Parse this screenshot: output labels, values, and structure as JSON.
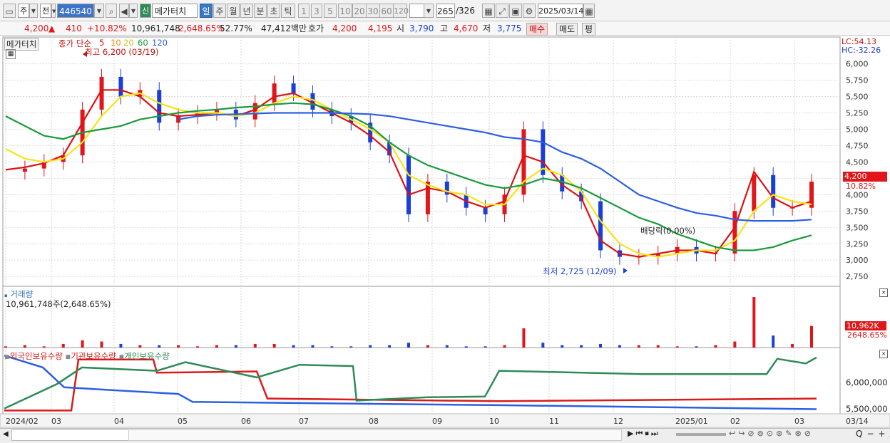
{
  "toolbar": {
    "market": "주",
    "type": "전",
    "code": "446540",
    "new_badge": "신",
    "stock_name": "메가터치",
    "periods": [
      "일",
      "주",
      "월",
      "년",
      "분",
      "초",
      "틱"
    ],
    "selected_period": "일",
    "minute_options": [
      "1",
      "3",
      "5",
      "10",
      "20",
      "30",
      "60",
      "120"
    ],
    "count": "265",
    "total": "/326",
    "date": "2025/03/14"
  },
  "quote": {
    "price": "4,200",
    "change": "410",
    "change_pct": "+10.82%",
    "volume": "10,961,748",
    "volume_pct": "2,648.65%",
    "turnover": "52.77%",
    "amount": "47,412백만",
    "hoga_label": "호가",
    "ask": "4,200",
    "bid": "4,195",
    "open_label": "시",
    "open": "3,790",
    "high_label": "고",
    "high": "4,670",
    "low_label": "저",
    "low": "3,775",
    "buy_label": "매수",
    "sell_label": "매도",
    "eval_label": "평"
  },
  "price_panel": {
    "name": "메가터치",
    "ma_label": "종가 단순",
    "ma_periods": [
      "5",
      "10",
      "20",
      "60",
      "120"
    ],
    "ma_colors": [
      "#dd1111",
      "#f08a10",
      "#f4e417",
      "#1a9a3a",
      "#2c5fe0"
    ],
    "high_note": "최고 6,200 (03/19)",
    "low_note": "최저 2,725 (12/09)",
    "dividend_note": "배당락(0.00%)",
    "lc": "LC:54.13",
    "hc": "HC:-32.26",
    "last_price": "4,200",
    "last_pct": "10.82%"
  },
  "volume_panel": {
    "title": "거래량",
    "info": "10,961,748주(2,648.65%)",
    "last_tag": "10,962K",
    "last_pct": "2648.65%"
  },
  "holdings_panel": {
    "legend": [
      "외국인보유수량",
      "기관보유수량",
      "개인보유수량"
    ],
    "colors": [
      "#d81b1b",
      "#2c5fe0",
      "#2e8b57"
    ],
    "axis_labels": [
      "6,000,000",
      "5,500,000"
    ]
  },
  "x_axis": [
    "2024/02",
    "03",
    "04",
    "05",
    "06",
    "07",
    "08",
    "09",
    "10",
    "11",
    "12",
    "2025/01",
    "02",
    "03"
  ],
  "x_end_label": "03/14",
  "chart_data": {
    "type": "candlestick",
    "title": "메가터치",
    "ylim": [
      2600,
      6300
    ],
    "y_ticks": [
      "6,000",
      "5,750",
      "5,500",
      "5,250",
      "5,000",
      "4,750",
      "4,500",
      "4,250",
      "4,000",
      "3,750",
      "3,500",
      "3,250",
      "3,000",
      "2,750"
    ],
    "series": [
      {
        "name": "close",
        "values": [
          4350,
          4400,
          4500,
          4600,
          5300,
          5800,
          5500,
          5600,
          5100,
          5200,
          5250,
          5300,
          5150,
          5400,
          5700,
          5550,
          5300,
          5200,
          5100,
          4800,
          4600,
          3700,
          4200,
          4000,
          3800,
          3700,
          4000,
          5000,
          4300,
          4050,
          3900,
          3150,
          3050,
          3050,
          3100,
          3200,
          3100,
          3100,
          3750,
          4300,
          3800,
          3800,
          4200
        ]
      },
      {
        "name": "ma5",
        "values": [
          4380,
          4420,
          4480,
          4600,
          5100,
          5600,
          5600,
          5500,
          5250,
          5200,
          5220,
          5250,
          5200,
          5300,
          5500,
          5550,
          5400,
          5250,
          5100,
          4900,
          4650,
          4000,
          4100,
          4050,
          3900,
          3800,
          3900,
          4600,
          4500,
          4150,
          3950,
          3300,
          3100,
          3050,
          3100,
          3150,
          3150,
          3100,
          3500,
          4350,
          3950,
          3800,
          3900
        ]
      },
      {
        "name": "ma20",
        "values": [
          4700,
          4550,
          4500,
          4550,
          4800,
          5200,
          5500,
          5550,
          5400,
          5300,
          5250,
          5250,
          5200,
          5250,
          5400,
          5500,
          5450,
          5300,
          5150,
          5000,
          4800,
          4300,
          4150,
          4050,
          4000,
          3850,
          3850,
          4200,
          4400,
          4300,
          4050,
          3600,
          3250,
          3100,
          3050,
          3100,
          3150,
          3150,
          3300,
          3750,
          4000,
          3900,
          3850
        ]
      },
      {
        "name": "ma60",
        "values": [
          5200,
          5050,
          4900,
          4850,
          4950,
          5000,
          5050,
          5150,
          5200,
          5250,
          5280,
          5300,
          5330,
          5350,
          5380,
          5400,
          5380,
          5300,
          5200,
          5050,
          4800,
          4600,
          4450,
          4350,
          4250,
          4150,
          4100,
          4150,
          4250,
          4200,
          4100,
          3950,
          3800,
          3650,
          3550,
          3400,
          3300,
          3200,
          3150,
          3150,
          3200,
          3300,
          3380
        ]
      },
      {
        "name": "ma120",
        "values": [
          null,
          null,
          null,
          null,
          null,
          null,
          null,
          null,
          null,
          5150,
          5200,
          5220,
          5230,
          5240,
          5250,
          5250,
          5250,
          5250,
          5240,
          5230,
          5200,
          5150,
          5100,
          5050,
          5000,
          4950,
          4880,
          4850,
          4800,
          4650,
          4550,
          4400,
          4200,
          4000,
          3900,
          3800,
          3720,
          3680,
          3620,
          3600,
          3600,
          3600,
          3620
        ]
      }
    ],
    "volume": [
      1,
      2,
      1,
      3,
      6,
      5,
      3,
      2,
      2,
      2,
      1,
      2,
      2,
      3,
      3,
      2,
      2,
      1,
      1,
      2,
      2,
      4,
      2,
      2,
      1,
      1,
      2,
      16,
      4,
      2,
      2,
      3,
      2,
      2,
      2,
      1,
      1,
      2,
      5,
      42,
      10,
      3,
      18
    ],
    "volume_ylim": [
      0,
      28000
    ],
    "volume_tick": "20,000K"
  }
}
